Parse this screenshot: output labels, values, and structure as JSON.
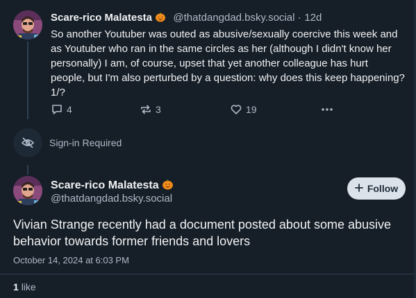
{
  "parent_post": {
    "author_name": "Scare-rico Malatesta",
    "handle": "@thatdangdad.bsky.social",
    "separator": "·",
    "age": "12d",
    "text": "So another Youtuber was outed as abusive/sexually coercive this week and as Youtuber who ran in the same circles as her (although I didn't know her personally) I am, of course, upset that yet another colleague has hurt people, but I'm also perturbed by a question: why does this keep happening? 1/?",
    "reply_count": "4",
    "repost_count": "3",
    "like_count": "19",
    "icons": [
      "reply-icon",
      "repost-icon",
      "like-icon",
      "more-icon"
    ]
  },
  "hidden_post": {
    "label": "Sign-in Required",
    "icon": "eye-slash-icon"
  },
  "main_post": {
    "author_name": "Scare-rico Malatesta",
    "handle": "@thatdangdad.bsky.social",
    "follow_label": "Follow",
    "text": "Vivian Strange recently had a document posted about some abusive behavior towards former friends and lovers",
    "timestamp": "October 14, 2024 at 6:03 PM",
    "like_total": "1",
    "like_word": "like"
  },
  "colors": {
    "background": "#161e27",
    "border": "#2e4052",
    "text_primary": "#f1f3f5",
    "text_secondary": "#aebbc9",
    "follow_button": "#dce2ea"
  }
}
